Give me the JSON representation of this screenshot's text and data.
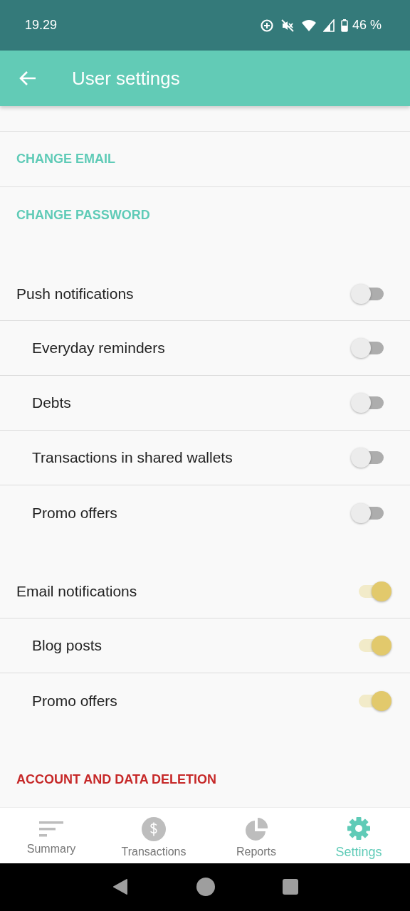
{
  "status_bar": {
    "time": "19.29",
    "battery": "46 %"
  },
  "header": {
    "title": "User settings"
  },
  "account_links": [
    {
      "label": "CHANGE EMAIL"
    },
    {
      "label": "CHANGE PASSWORD"
    }
  ],
  "toggle_groups": [
    {
      "title": "Push notifications",
      "on": false,
      "items": [
        {
          "label": "Everyday reminders",
          "on": false
        },
        {
          "label": "Debts",
          "on": false
        },
        {
          "label": "Transactions in shared wallets",
          "on": false
        },
        {
          "label": "Promo offers",
          "on": false
        }
      ]
    },
    {
      "title": "Email notifications",
      "on": true,
      "items": [
        {
          "label": "Blog posts",
          "on": true
        },
        {
          "label": "Promo offers",
          "on": true
        }
      ]
    }
  ],
  "danger_link": {
    "label": "ACCOUNT AND DATA DELETION"
  },
  "nav": [
    {
      "label": "Summary",
      "kind": "summary",
      "selected": false
    },
    {
      "label": "Transactions",
      "kind": "transactions",
      "selected": false
    },
    {
      "label": "Reports",
      "kind": "reports",
      "selected": false
    },
    {
      "label": "Settings",
      "kind": "settings",
      "selected": true
    }
  ]
}
